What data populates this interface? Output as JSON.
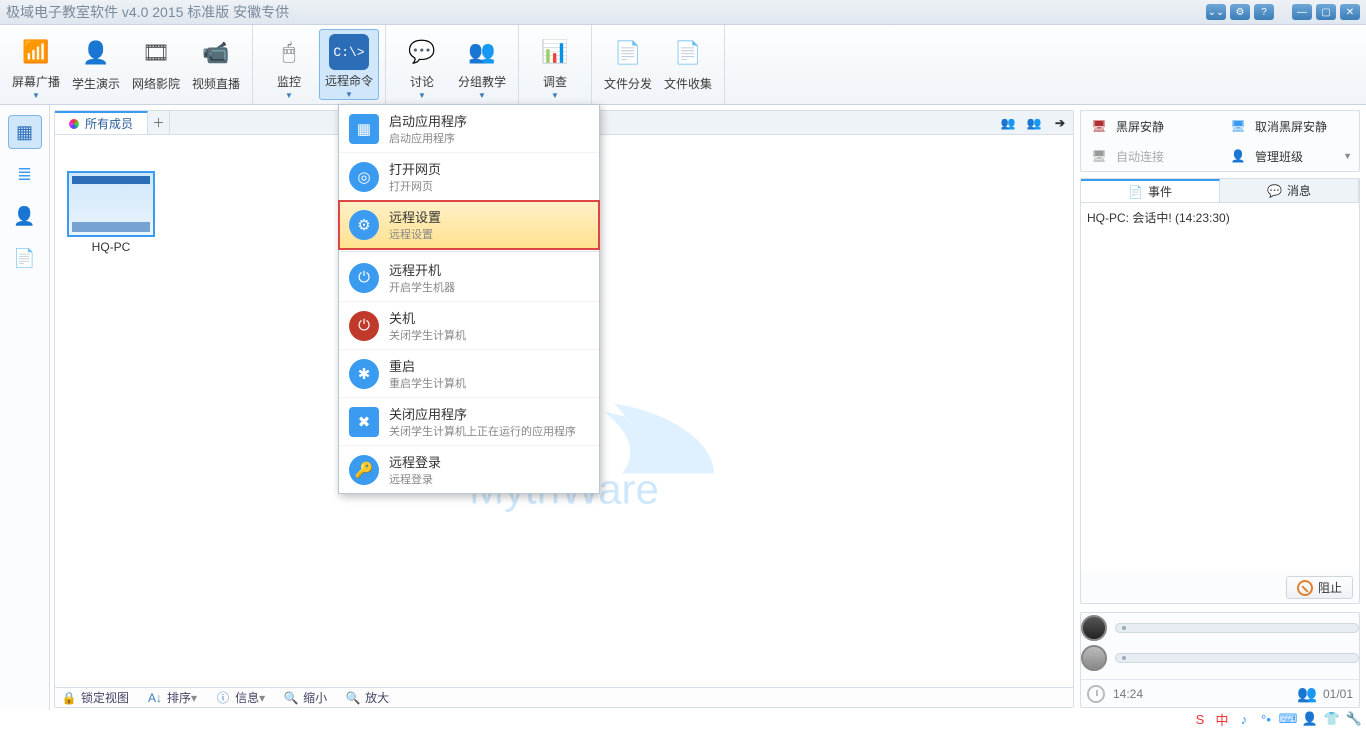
{
  "title": "极域电子教室软件 v4.0 2015 标准版 安徽专供",
  "titlebar_buttons": [
    "⌄⌄",
    "⚙",
    "?",
    "—",
    "▢",
    "✕"
  ],
  "toolbar_groups": [
    [
      {
        "label": "屏幕广播",
        "icon": "📶",
        "color": "#f6a623",
        "drop": true
      },
      {
        "label": "学生演示",
        "icon": "👤",
        "color": "#4aa3e8"
      },
      {
        "label": "网络影院",
        "icon": "🎞",
        "color": "#555"
      },
      {
        "label": "视频直播",
        "icon": "📹",
        "color": "#3b9bf0"
      }
    ],
    [
      {
        "label": "监控",
        "icon": "🖱",
        "color": "#666",
        "drop": true
      },
      {
        "label": "远程命令",
        "icon": "C:\\>",
        "color": "#fff",
        "bg": "#2b6db6",
        "active": true,
        "drop": true
      }
    ],
    [
      {
        "label": "讨论",
        "icon": "💬",
        "color": "#4aa3e8",
        "drop": true
      },
      {
        "label": "分组教学",
        "icon": "👥",
        "color": "#4aa3e8",
        "drop": true
      }
    ],
    [
      {
        "label": "调查",
        "icon": "📊",
        "color": "#4aa3e8",
        "drop": true
      }
    ],
    [
      {
        "label": "文件分发",
        "icon": "📄",
        "color": "#4aa3e8"
      },
      {
        "label": "文件收集",
        "icon": "📄",
        "color": "#f59e0b"
      }
    ]
  ],
  "leftnav": [
    {
      "icon": "▦",
      "sel": true
    },
    {
      "icon": "≣"
    },
    {
      "icon": "👤"
    },
    {
      "icon": "📄"
    }
  ],
  "tab": {
    "label": "所有成员"
  },
  "student": {
    "name": "HQ-PC"
  },
  "menu": [
    {
      "title": "启动应用程序",
      "sub": "启动应用程序",
      "icon": "▦",
      "bg": "#3b9bf0",
      "square": true
    },
    {
      "title": "打开网页",
      "sub": "打开网页",
      "icon": "◎",
      "bg": "#3b9bf0"
    },
    {
      "title": "远程设置",
      "sub": "远程设置",
      "icon": "⚙",
      "bg": "#3b9bf0",
      "hl": true
    },
    {
      "sep": true
    },
    {
      "title": "远程开机",
      "sub": "开启学生机器",
      "icon": "⏻",
      "bg": "#3b9bf0"
    },
    {
      "title": "关机",
      "sub": "关闭学生计算机",
      "icon": "⏻",
      "bg": "#c0392b"
    },
    {
      "title": "重启",
      "sub": "重启学生计算机",
      "icon": "✱",
      "bg": "#3b9bf0"
    },
    {
      "title": "关闭应用程序",
      "sub": "关闭学生计算机上正在运行的应用程序",
      "icon": "✖",
      "bg": "#3b9bf0",
      "square": true
    },
    {
      "title": "远程登录",
      "sub": "远程登录",
      "icon": "🔑",
      "bg": "#3b9bf0"
    }
  ],
  "rightpanel": {
    "row1": [
      {
        "label": "黑屏安静",
        "icon": "🖥",
        "iconColor": "#b03030"
      },
      {
        "label": "取消黑屏安静",
        "icon": "🖥",
        "iconColor": "#3b9bf0"
      }
    ],
    "row2": [
      {
        "label": "自动连接",
        "icon": "🖥",
        "iconColor": "#999",
        "disabled": true
      },
      {
        "label": "管理班级",
        "icon": "👤",
        "iconColor": "#3b9bf0",
        "drop": true
      }
    ],
    "tabs": [
      {
        "label": "事件",
        "icon": "📄",
        "sel": true
      },
      {
        "label": "消息",
        "icon": "💬"
      }
    ],
    "log": "HQ-PC: 会话中! (14:23:30)",
    "stop": "阻止",
    "time": "14:24",
    "count": "01/01"
  },
  "statusbar": [
    {
      "label": "锁定视图",
      "icon": "🔒"
    },
    {
      "label": "排序",
      "icon": "A↓",
      "drop": true
    },
    {
      "label": "信息",
      "icon": "ⓘ",
      "drop": true
    },
    {
      "label": "缩小",
      "icon": "🔍"
    },
    {
      "label": "放大",
      "icon": "🔍"
    }
  ],
  "watermark": "MythWare",
  "tray": [
    "S",
    "中",
    "♪",
    "°•",
    "⌨",
    "👤",
    "👕",
    "🔧"
  ]
}
